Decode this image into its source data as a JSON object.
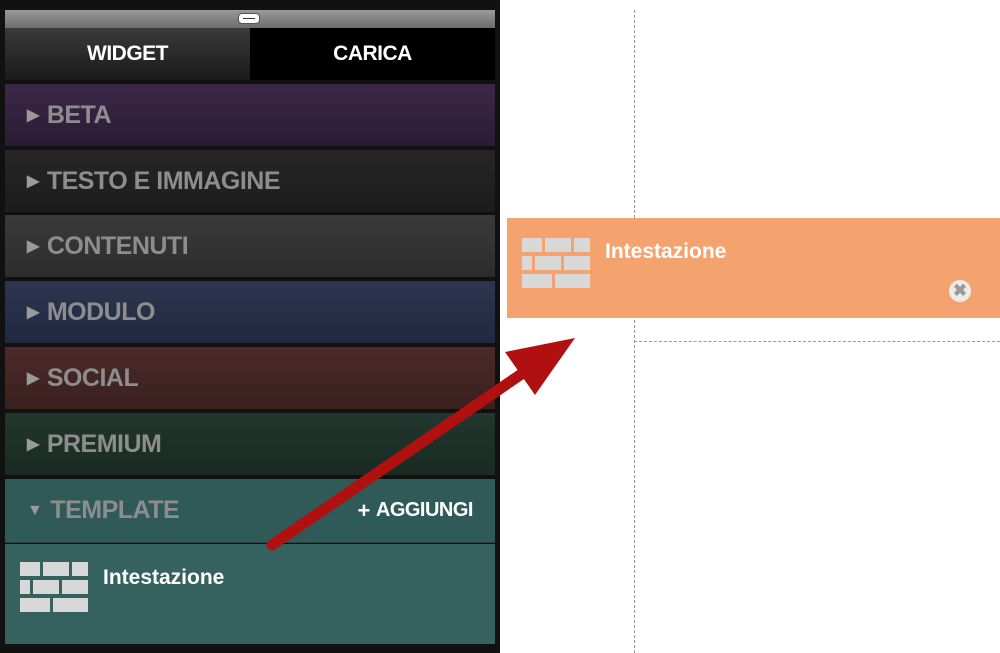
{
  "tabs": {
    "widget": "WIDGET",
    "carica": "CARICA"
  },
  "categories": [
    {
      "label": "BETA",
      "indicator": "▶"
    },
    {
      "label": "TESTO E IMMAGINE",
      "indicator": "▶"
    },
    {
      "label": "CONTENUTI",
      "indicator": "▶"
    },
    {
      "label": "MODULO",
      "indicator": "▶"
    },
    {
      "label": "SOCIAL",
      "indicator": "▶"
    },
    {
      "label": "PREMIUM",
      "indicator": "▶"
    },
    {
      "label": "TEMPLATE",
      "indicator": "▼",
      "expanded": true
    }
  ],
  "template_section": {
    "add_label": "AGGIUNGI",
    "items": [
      {
        "label": "Intestazione",
        "icon": "bricks-icon"
      }
    ]
  },
  "dropped_widget": {
    "label": "Intestazione",
    "icon": "bricks-icon",
    "close_icon": "close-icon"
  },
  "colors": {
    "drop_highlight": "#f4a36f",
    "template_bg": "#35625f",
    "arrow": "#b01010"
  }
}
